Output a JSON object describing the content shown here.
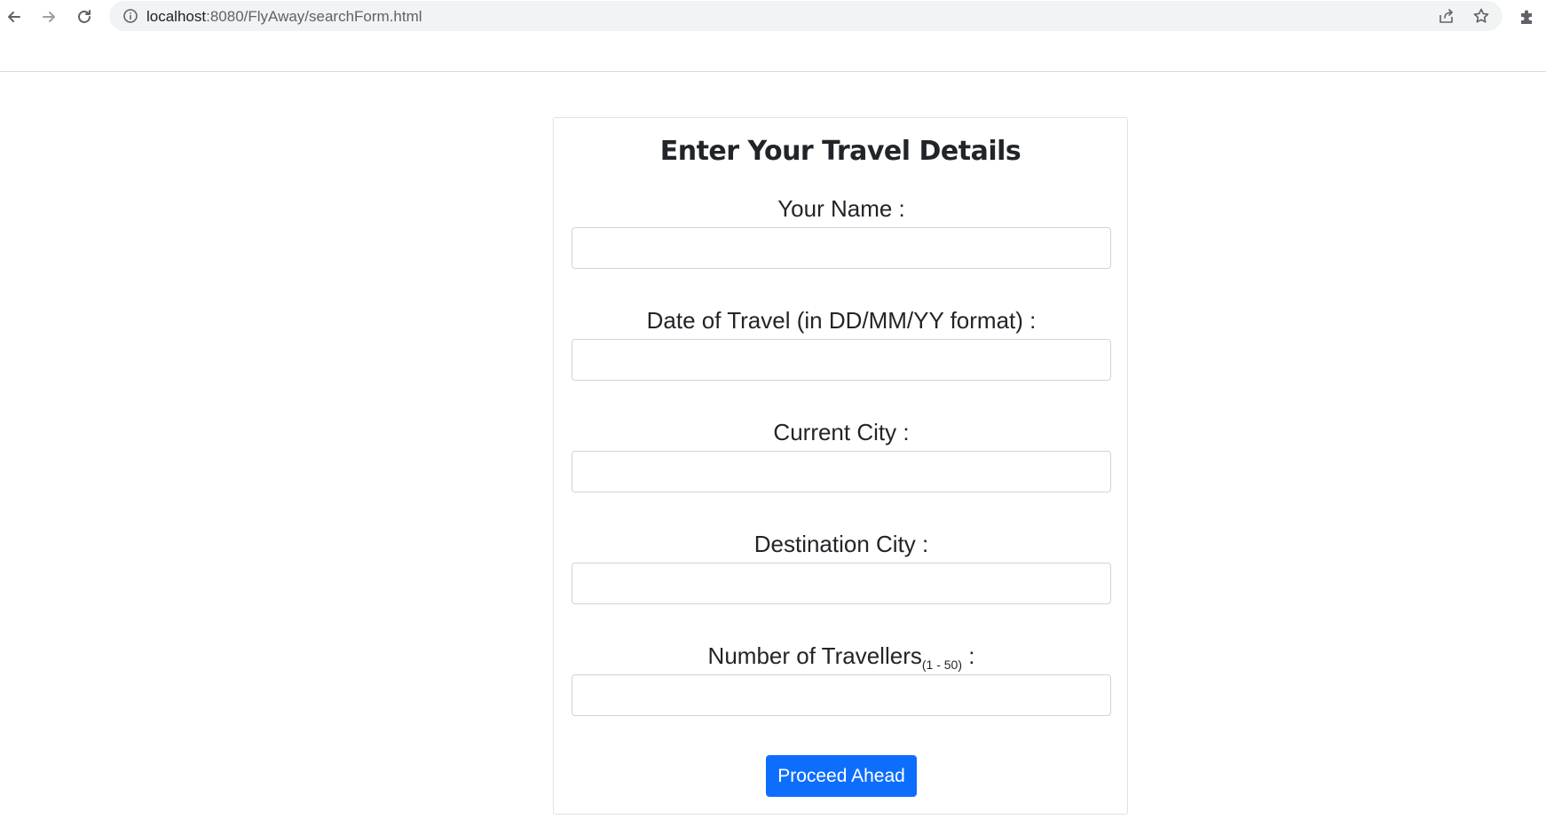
{
  "browser": {
    "url_host": "localhost",
    "url_rest": ":8080/FlyAway/searchForm.html",
    "icons": {
      "back": "arrow-left-icon",
      "forward": "arrow-right-icon",
      "reload": "reload-icon",
      "site_info": "info-icon",
      "share": "share-icon",
      "bookmark": "star-icon",
      "extensions": "puzzle-icon"
    }
  },
  "form": {
    "title": "Enter Your Travel Details",
    "fields": [
      {
        "label": "Your Name :",
        "value": ""
      },
      {
        "label": "Date of Travel (in DD/MM/YY format) :",
        "value": ""
      },
      {
        "label": "Current City :",
        "value": ""
      },
      {
        "label": "Destination City :",
        "value": ""
      },
      {
        "label": "Number of Travellers",
        "label_sub": "(1 - 50)",
        "label_suffix": " :",
        "value": ""
      }
    ],
    "submit_label": "Proceed Ahead"
  },
  "colors": {
    "primary": "#0d6efd",
    "border": "#ced4da",
    "text": "#212529"
  }
}
